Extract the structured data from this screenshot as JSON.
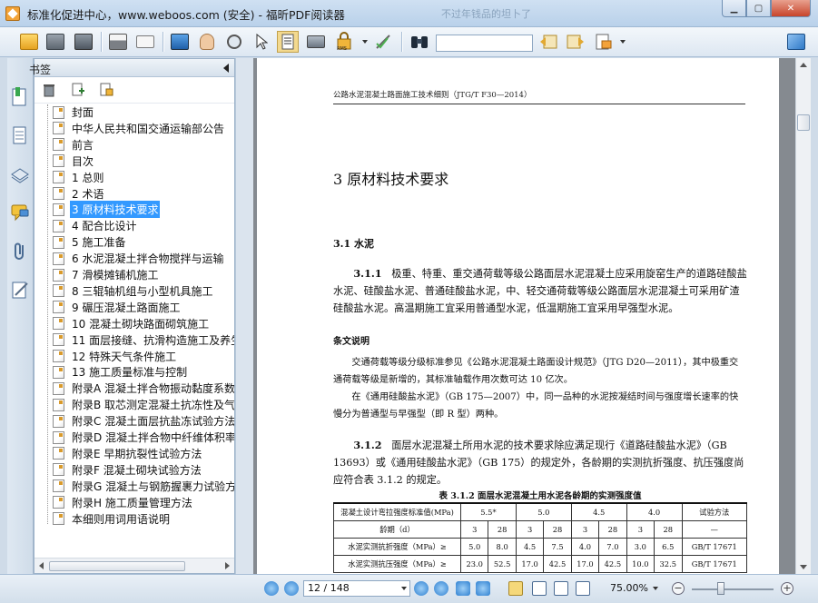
{
  "window": {
    "title": "标准化促进中心，www.weboos.com (安全) - 福昕PDF阅读器",
    "ghost_tab": "不过年钱品的坦卜了",
    "minimize": "▁",
    "maximize": "▢",
    "close": "✕"
  },
  "toolbar": {
    "icons": [
      "open-folder-icon",
      "save-icon",
      "save-as-icon",
      "print-icon",
      "email-icon",
      "fullscreen-monitor-icon",
      "hand-tool-icon",
      "zoom-glass-icon",
      "select-arrow-icon",
      "text-select-icon",
      "snapshot-camera-icon",
      "rms-lock-icon",
      "signature-icon",
      "binoculars-icon",
      "find-previous-icon",
      "find-next-icon",
      "highlight-tool-icon",
      "expand-window-icon"
    ],
    "search_value": "",
    "rms_label": "RMS"
  },
  "sidebar": {
    "title": "书签",
    "bookmarks": [
      {
        "label": "封面"
      },
      {
        "label": "中华人民共和国交通运输部公告"
      },
      {
        "label": "前言"
      },
      {
        "label": "目次"
      },
      {
        "label": "1 总则"
      },
      {
        "label": "2 术语"
      },
      {
        "label": "3 原材料技术要求",
        "selected": true
      },
      {
        "label": "4 配合比设计"
      },
      {
        "label": "5 施工准备"
      },
      {
        "label": "6 水泥混凝土拌合物搅拌与运输"
      },
      {
        "label": "7 滑模摊铺机施工"
      },
      {
        "label": "8 三辊轴机组与小型机具施工"
      },
      {
        "label": "9 碾压混凝土路面施工"
      },
      {
        "label": "10 混凝土砌块路面砌筑施工"
      },
      {
        "label": "11 面层接缝、抗滑构造施工及养生"
      },
      {
        "label": "12 特殊天气条件施工"
      },
      {
        "label": "13 施工质量标准与控制"
      },
      {
        "label": "附录A 混凝土拌合物振动黏度系数"
      },
      {
        "label": "附录B 取芯测定混凝土抗冻性及气"
      },
      {
        "label": "附录C 混凝土面层抗盐冻试验方法"
      },
      {
        "label": "附录D 混凝土拌合物中纤维体积率"
      },
      {
        "label": "附录E 早期抗裂性试验方法"
      },
      {
        "label": "附录F 混凝土砌块试验方法"
      },
      {
        "label": "附录G 混凝土与钢筋握裹力试验方"
      },
      {
        "label": "附录H 施工质量管理方法"
      },
      {
        "label": "本细则用词用语说明"
      }
    ]
  },
  "document": {
    "running_header": "公路水泥混凝土路面施工技术细则（JTG/T F30—2014）",
    "chapter_title": "3   原材料技术要求",
    "section_title": "3.1   水泥",
    "para_311_num": "3.1.1",
    "para_311": "极重、特重、重交通荷载等级公路面层水泥混凝土应采用旋窑生产的道路硅酸盐水泥、硅酸盐水泥、普通硅酸盐水泥，中、轻交通荷载等级公路面层水泥混凝土可采用矿渣硅酸盐水泥。高温期施工宜采用普通型水泥，低温期施工宜采用早强型水泥。",
    "note_title": "条文说明",
    "note_1": "交通荷载等级分级标准参见《公路水泥混凝土路面设计规范》（JTG D20—2011），其中极重交通荷载等级是新增的，其标准轴载作用次数可达 10 亿次。",
    "note_2": "在《通用硅酸盐水泥》（GB 175—2007）中，同一品种的水泥按凝结时间与强度增长速率的快慢分为普通型与早强型（即 R 型）两种。",
    "para_312_num": "3.1.2",
    "para_312": "面层水泥混凝土所用水泥的技术要求除应满足现行《道路硅酸盐水泥》（GB 13693）或《通用硅酸盐水泥》（GB 175）的规定外，各龄期的实测抗折强度、抗压强度尚应符合表 3.1.2 的规定。",
    "table_caption": "表 3.1.2   面层水泥混凝土用水泥各龄期的实测强度值",
    "table": {
      "row_header": [
        "混凝土设计弯拉强度标准值(MPa)",
        "5.5*",
        "5.0",
        "4.5",
        "4.0",
        "试验方法"
      ],
      "row_age": [
        "龄期（d）",
        "3",
        "28",
        "3",
        "28",
        "3",
        "28",
        "3",
        "28",
        "—"
      ],
      "row_flex": [
        "水泥实测抗折强度（MPa）≥",
        "5.0",
        "8.0",
        "4.5",
        "7.5",
        "4.0",
        "7.0",
        "3.0",
        "6.5",
        "GB/T 17671"
      ],
      "row_comp": [
        "水泥实测抗压强度（MPa）≥",
        "23.0",
        "52.5",
        "17.0",
        "42.5",
        "17.0",
        "42.5",
        "10.0",
        "32.5",
        "GB/T 17671"
      ]
    }
  },
  "statusbar": {
    "page_indicator": "12 / 148",
    "current_page": 12,
    "total_pages": 148,
    "zoom": "75.00%"
  }
}
